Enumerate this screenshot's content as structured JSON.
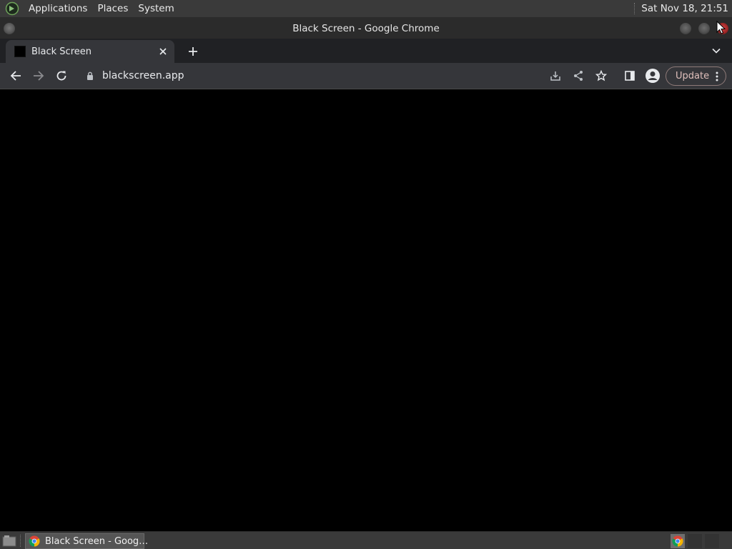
{
  "top_panel": {
    "menus": [
      "Applications",
      "Places",
      "System"
    ],
    "clock": "Sat Nov 18, 21:51"
  },
  "window": {
    "title": "Black Screen - Google Chrome"
  },
  "tabs": [
    {
      "title": "Black Screen",
      "favicon_color": "#000000",
      "active": true
    }
  ],
  "toolbar": {
    "url": "blackscreen.app",
    "update_label": "Update"
  },
  "page": {
    "background": "#000000"
  },
  "taskbar": {
    "items": [
      {
        "label": "Black Screen - Goog…",
        "icon": "chrome-icon"
      }
    ]
  },
  "colors": {
    "panel": "#3a3a3a",
    "tabstrip": "#202124",
    "toolbar": "#35363a",
    "close_button": "#c03030"
  }
}
